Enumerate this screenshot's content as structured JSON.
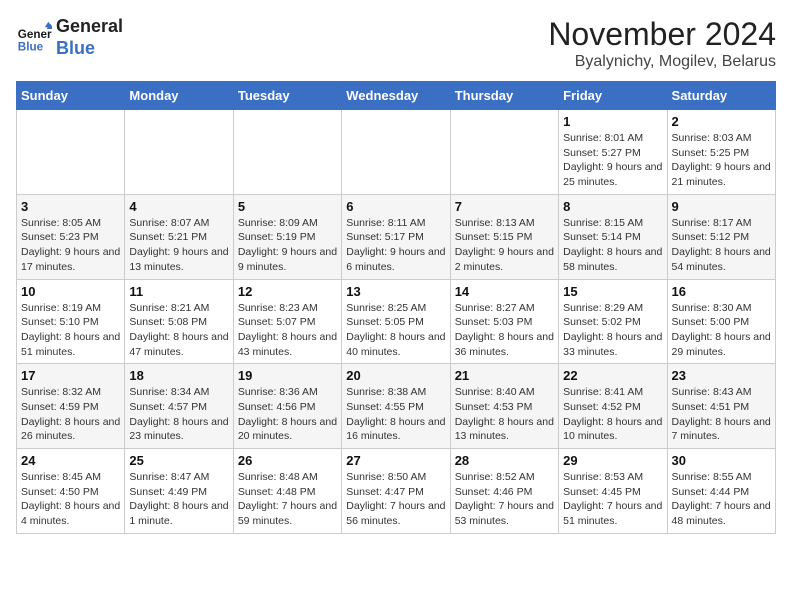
{
  "logo": {
    "line1": "General",
    "line2": "Blue"
  },
  "title": "November 2024",
  "subtitle": "Byalynichy, Mogilev, Belarus",
  "days_of_week": [
    "Sunday",
    "Monday",
    "Tuesday",
    "Wednesday",
    "Thursday",
    "Friday",
    "Saturday"
  ],
  "weeks": [
    [
      {
        "day": "",
        "info": ""
      },
      {
        "day": "",
        "info": ""
      },
      {
        "day": "",
        "info": ""
      },
      {
        "day": "",
        "info": ""
      },
      {
        "day": "",
        "info": ""
      },
      {
        "day": "1",
        "info": "Sunrise: 8:01 AM\nSunset: 5:27 PM\nDaylight: 9 hours and 25 minutes."
      },
      {
        "day": "2",
        "info": "Sunrise: 8:03 AM\nSunset: 5:25 PM\nDaylight: 9 hours and 21 minutes."
      }
    ],
    [
      {
        "day": "3",
        "info": "Sunrise: 8:05 AM\nSunset: 5:23 PM\nDaylight: 9 hours and 17 minutes."
      },
      {
        "day": "4",
        "info": "Sunrise: 8:07 AM\nSunset: 5:21 PM\nDaylight: 9 hours and 13 minutes."
      },
      {
        "day": "5",
        "info": "Sunrise: 8:09 AM\nSunset: 5:19 PM\nDaylight: 9 hours and 9 minutes."
      },
      {
        "day": "6",
        "info": "Sunrise: 8:11 AM\nSunset: 5:17 PM\nDaylight: 9 hours and 6 minutes."
      },
      {
        "day": "7",
        "info": "Sunrise: 8:13 AM\nSunset: 5:15 PM\nDaylight: 9 hours and 2 minutes."
      },
      {
        "day": "8",
        "info": "Sunrise: 8:15 AM\nSunset: 5:14 PM\nDaylight: 8 hours and 58 minutes."
      },
      {
        "day": "9",
        "info": "Sunrise: 8:17 AM\nSunset: 5:12 PM\nDaylight: 8 hours and 54 minutes."
      }
    ],
    [
      {
        "day": "10",
        "info": "Sunrise: 8:19 AM\nSunset: 5:10 PM\nDaylight: 8 hours and 51 minutes."
      },
      {
        "day": "11",
        "info": "Sunrise: 8:21 AM\nSunset: 5:08 PM\nDaylight: 8 hours and 47 minutes."
      },
      {
        "day": "12",
        "info": "Sunrise: 8:23 AM\nSunset: 5:07 PM\nDaylight: 8 hours and 43 minutes."
      },
      {
        "day": "13",
        "info": "Sunrise: 8:25 AM\nSunset: 5:05 PM\nDaylight: 8 hours and 40 minutes."
      },
      {
        "day": "14",
        "info": "Sunrise: 8:27 AM\nSunset: 5:03 PM\nDaylight: 8 hours and 36 minutes."
      },
      {
        "day": "15",
        "info": "Sunrise: 8:29 AM\nSunset: 5:02 PM\nDaylight: 8 hours and 33 minutes."
      },
      {
        "day": "16",
        "info": "Sunrise: 8:30 AM\nSunset: 5:00 PM\nDaylight: 8 hours and 29 minutes."
      }
    ],
    [
      {
        "day": "17",
        "info": "Sunrise: 8:32 AM\nSunset: 4:59 PM\nDaylight: 8 hours and 26 minutes."
      },
      {
        "day": "18",
        "info": "Sunrise: 8:34 AM\nSunset: 4:57 PM\nDaylight: 8 hours and 23 minutes."
      },
      {
        "day": "19",
        "info": "Sunrise: 8:36 AM\nSunset: 4:56 PM\nDaylight: 8 hours and 20 minutes."
      },
      {
        "day": "20",
        "info": "Sunrise: 8:38 AM\nSunset: 4:55 PM\nDaylight: 8 hours and 16 minutes."
      },
      {
        "day": "21",
        "info": "Sunrise: 8:40 AM\nSunset: 4:53 PM\nDaylight: 8 hours and 13 minutes."
      },
      {
        "day": "22",
        "info": "Sunrise: 8:41 AM\nSunset: 4:52 PM\nDaylight: 8 hours and 10 minutes."
      },
      {
        "day": "23",
        "info": "Sunrise: 8:43 AM\nSunset: 4:51 PM\nDaylight: 8 hours and 7 minutes."
      }
    ],
    [
      {
        "day": "24",
        "info": "Sunrise: 8:45 AM\nSunset: 4:50 PM\nDaylight: 8 hours and 4 minutes."
      },
      {
        "day": "25",
        "info": "Sunrise: 8:47 AM\nSunset: 4:49 PM\nDaylight: 8 hours and 1 minute."
      },
      {
        "day": "26",
        "info": "Sunrise: 8:48 AM\nSunset: 4:48 PM\nDaylight: 7 hours and 59 minutes."
      },
      {
        "day": "27",
        "info": "Sunrise: 8:50 AM\nSunset: 4:47 PM\nDaylight: 7 hours and 56 minutes."
      },
      {
        "day": "28",
        "info": "Sunrise: 8:52 AM\nSunset: 4:46 PM\nDaylight: 7 hours and 53 minutes."
      },
      {
        "day": "29",
        "info": "Sunrise: 8:53 AM\nSunset: 4:45 PM\nDaylight: 7 hours and 51 minutes."
      },
      {
        "day": "30",
        "info": "Sunrise: 8:55 AM\nSunset: 4:44 PM\nDaylight: 7 hours and 48 minutes."
      }
    ]
  ]
}
